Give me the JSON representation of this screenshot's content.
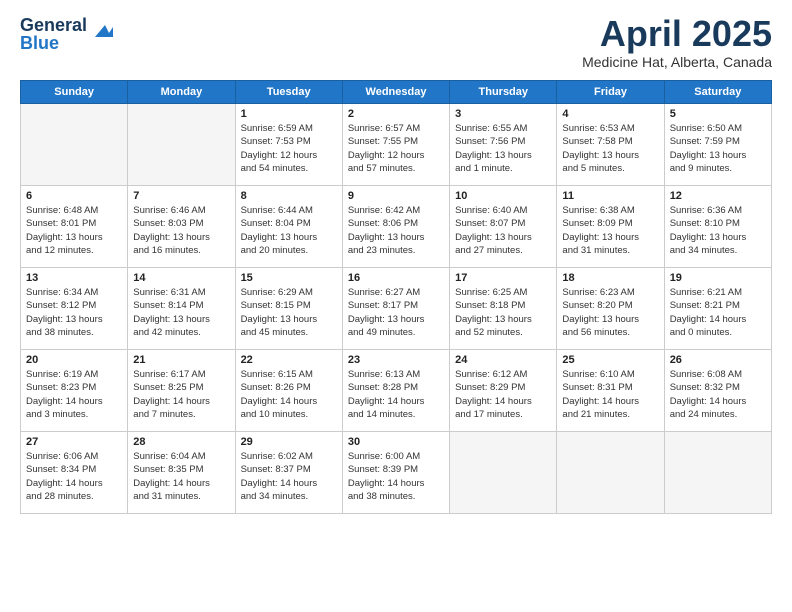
{
  "header": {
    "logo_line1": "General",
    "logo_line2": "Blue",
    "month": "April 2025",
    "location": "Medicine Hat, Alberta, Canada"
  },
  "days_of_week": [
    "Sunday",
    "Monday",
    "Tuesday",
    "Wednesday",
    "Thursday",
    "Friday",
    "Saturday"
  ],
  "weeks": [
    [
      {
        "day": "",
        "info": ""
      },
      {
        "day": "",
        "info": ""
      },
      {
        "day": "1",
        "info": "Sunrise: 6:59 AM\nSunset: 7:53 PM\nDaylight: 12 hours\nand 54 minutes."
      },
      {
        "day": "2",
        "info": "Sunrise: 6:57 AM\nSunset: 7:55 PM\nDaylight: 12 hours\nand 57 minutes."
      },
      {
        "day": "3",
        "info": "Sunrise: 6:55 AM\nSunset: 7:56 PM\nDaylight: 13 hours\nand 1 minute."
      },
      {
        "day": "4",
        "info": "Sunrise: 6:53 AM\nSunset: 7:58 PM\nDaylight: 13 hours\nand 5 minutes."
      },
      {
        "day": "5",
        "info": "Sunrise: 6:50 AM\nSunset: 7:59 PM\nDaylight: 13 hours\nand 9 minutes."
      }
    ],
    [
      {
        "day": "6",
        "info": "Sunrise: 6:48 AM\nSunset: 8:01 PM\nDaylight: 13 hours\nand 12 minutes."
      },
      {
        "day": "7",
        "info": "Sunrise: 6:46 AM\nSunset: 8:03 PM\nDaylight: 13 hours\nand 16 minutes."
      },
      {
        "day": "8",
        "info": "Sunrise: 6:44 AM\nSunset: 8:04 PM\nDaylight: 13 hours\nand 20 minutes."
      },
      {
        "day": "9",
        "info": "Sunrise: 6:42 AM\nSunset: 8:06 PM\nDaylight: 13 hours\nand 23 minutes."
      },
      {
        "day": "10",
        "info": "Sunrise: 6:40 AM\nSunset: 8:07 PM\nDaylight: 13 hours\nand 27 minutes."
      },
      {
        "day": "11",
        "info": "Sunrise: 6:38 AM\nSunset: 8:09 PM\nDaylight: 13 hours\nand 31 minutes."
      },
      {
        "day": "12",
        "info": "Sunrise: 6:36 AM\nSunset: 8:10 PM\nDaylight: 13 hours\nand 34 minutes."
      }
    ],
    [
      {
        "day": "13",
        "info": "Sunrise: 6:34 AM\nSunset: 8:12 PM\nDaylight: 13 hours\nand 38 minutes."
      },
      {
        "day": "14",
        "info": "Sunrise: 6:31 AM\nSunset: 8:14 PM\nDaylight: 13 hours\nand 42 minutes."
      },
      {
        "day": "15",
        "info": "Sunrise: 6:29 AM\nSunset: 8:15 PM\nDaylight: 13 hours\nand 45 minutes."
      },
      {
        "day": "16",
        "info": "Sunrise: 6:27 AM\nSunset: 8:17 PM\nDaylight: 13 hours\nand 49 minutes."
      },
      {
        "day": "17",
        "info": "Sunrise: 6:25 AM\nSunset: 8:18 PM\nDaylight: 13 hours\nand 52 minutes."
      },
      {
        "day": "18",
        "info": "Sunrise: 6:23 AM\nSunset: 8:20 PM\nDaylight: 13 hours\nand 56 minutes."
      },
      {
        "day": "19",
        "info": "Sunrise: 6:21 AM\nSunset: 8:21 PM\nDaylight: 14 hours\nand 0 minutes."
      }
    ],
    [
      {
        "day": "20",
        "info": "Sunrise: 6:19 AM\nSunset: 8:23 PM\nDaylight: 14 hours\nand 3 minutes."
      },
      {
        "day": "21",
        "info": "Sunrise: 6:17 AM\nSunset: 8:25 PM\nDaylight: 14 hours\nand 7 minutes."
      },
      {
        "day": "22",
        "info": "Sunrise: 6:15 AM\nSunset: 8:26 PM\nDaylight: 14 hours\nand 10 minutes."
      },
      {
        "day": "23",
        "info": "Sunrise: 6:13 AM\nSunset: 8:28 PM\nDaylight: 14 hours\nand 14 minutes."
      },
      {
        "day": "24",
        "info": "Sunrise: 6:12 AM\nSunset: 8:29 PM\nDaylight: 14 hours\nand 17 minutes."
      },
      {
        "day": "25",
        "info": "Sunrise: 6:10 AM\nSunset: 8:31 PM\nDaylight: 14 hours\nand 21 minutes."
      },
      {
        "day": "26",
        "info": "Sunrise: 6:08 AM\nSunset: 8:32 PM\nDaylight: 14 hours\nand 24 minutes."
      }
    ],
    [
      {
        "day": "27",
        "info": "Sunrise: 6:06 AM\nSunset: 8:34 PM\nDaylight: 14 hours\nand 28 minutes."
      },
      {
        "day": "28",
        "info": "Sunrise: 6:04 AM\nSunset: 8:35 PM\nDaylight: 14 hours\nand 31 minutes."
      },
      {
        "day": "29",
        "info": "Sunrise: 6:02 AM\nSunset: 8:37 PM\nDaylight: 14 hours\nand 34 minutes."
      },
      {
        "day": "30",
        "info": "Sunrise: 6:00 AM\nSunset: 8:39 PM\nDaylight: 14 hours\nand 38 minutes."
      },
      {
        "day": "",
        "info": ""
      },
      {
        "day": "",
        "info": ""
      },
      {
        "day": "",
        "info": ""
      }
    ]
  ]
}
